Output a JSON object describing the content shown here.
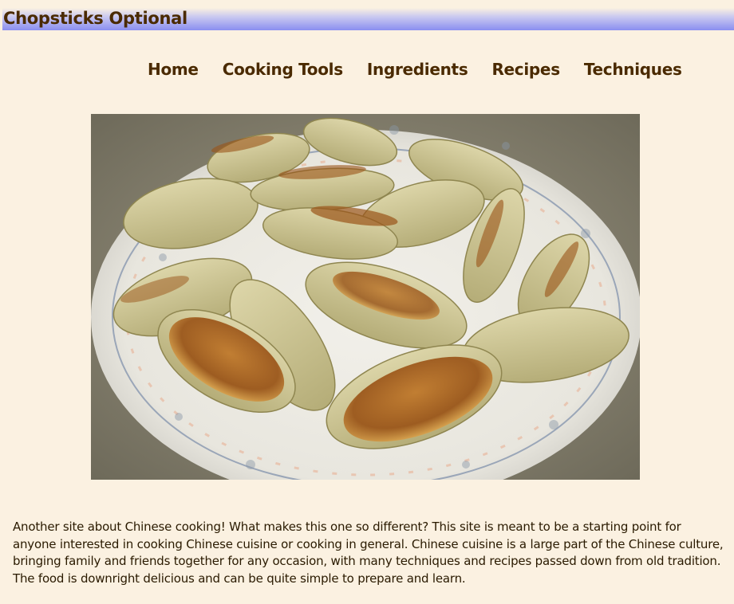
{
  "site": {
    "title": "Chopsticks Optional"
  },
  "nav": {
    "items": [
      {
        "label": "Home"
      },
      {
        "label": "Cooking Tools"
      },
      {
        "label": "Ingredients"
      },
      {
        "label": "Recipes"
      },
      {
        "label": "Techniques"
      }
    ]
  },
  "hero": {
    "image": "photo of pan-fried dumplings on a floral-rimmed white plate"
  },
  "intro": {
    "text": "Another site about Chinese cooking! What makes this one so different? This site is meant to be a starting point for anyone interested in cooking Chinese cuisine or cooking in general. Chinese cuisine is a large part of the Chinese culture, bringing family and friends together for any occasion, with many techniques and recipes passed down from old tradition. The food is downright delicious and can be quite simple to prepare and learn."
  },
  "colors": {
    "background": "#fbf1e1",
    "header_gradient_end": "#8a8ef0",
    "text": "#4a2a00"
  }
}
